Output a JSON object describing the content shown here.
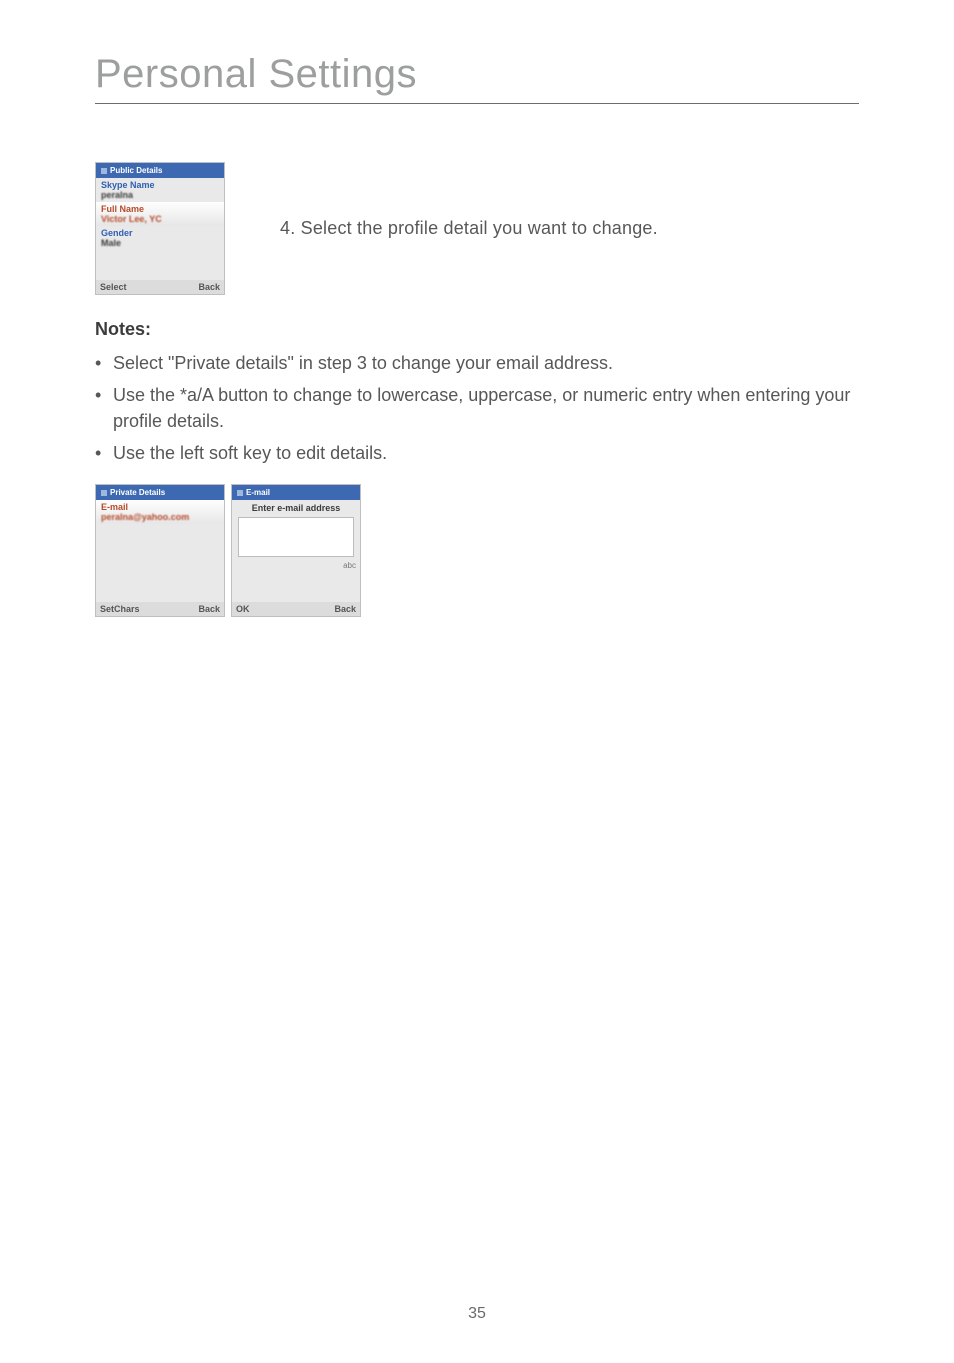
{
  "page": {
    "title": "Personal Settings",
    "number": "35"
  },
  "step4": "4. Select the profile detail you want to change.",
  "notes": {
    "heading": "Notes:",
    "items": [
      "Select \"Private details\" in step 3 to change your email address.",
      "Use the *a/A button to change to lowercase, uppercase, or numeric entry when entering your profile details.",
      "Use the left soft key to edit details."
    ]
  },
  "mock1": {
    "header": "Public Details",
    "f1_label": "Skype Name",
    "f1_value": "peralna",
    "f2_label": "Full Name",
    "f2_value": "Victor Lee, YC",
    "f3_label": "Gender",
    "f3_value": "Male",
    "soft_left": "Select",
    "soft_right": "Back"
  },
  "mock2": {
    "header": "Private Details",
    "f1_label": "E-mail",
    "f1_value": "peralna@yahoo.com",
    "soft_left": "SetChars",
    "soft_right": "Back"
  },
  "mock3": {
    "header": "E-mail",
    "prompt": "Enter e-mail address",
    "abc": "abc",
    "soft_left": "OK",
    "soft_right": "Back"
  }
}
